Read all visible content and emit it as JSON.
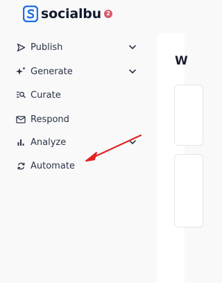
{
  "brand": {
    "name": "socialbu",
    "badge": "2"
  },
  "sidebar": {
    "items": [
      {
        "label": "Publish",
        "icon": "send-icon",
        "has_submenu": true
      },
      {
        "label": "Generate",
        "icon": "sparkles-icon",
        "has_submenu": true
      },
      {
        "label": "Curate",
        "icon": "search-list-icon",
        "has_submenu": false
      },
      {
        "label": "Respond",
        "icon": "mail-icon",
        "has_submenu": false
      },
      {
        "label": "Analyze",
        "icon": "bar-chart-icon",
        "has_submenu": true
      },
      {
        "label": "Automate",
        "icon": "refresh-icon",
        "has_submenu": false
      }
    ]
  },
  "main": {
    "title": "W"
  },
  "colors": {
    "brand_blue": "#1f6fe5",
    "badge_red": "#d65a6a",
    "arrow_red": "#e02424"
  }
}
